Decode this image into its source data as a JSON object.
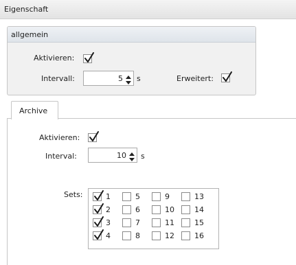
{
  "property_panel": {
    "title": "Eigenschaft"
  },
  "general_group": {
    "title": "allgemein",
    "activate_label": "Aktivieren:",
    "activate_checked": true,
    "interval_label": "Intervall:",
    "interval_value": "5",
    "interval_unit": "s",
    "extended_label": "Erweitert:",
    "extended_checked": true
  },
  "tabs": [
    {
      "label": "Archive",
      "active": true
    }
  ],
  "archive": {
    "activate_label": "Aktivieren:",
    "activate_checked": true,
    "interval_label": "Interval:",
    "interval_value": "10",
    "interval_unit": "s",
    "sets_label": "Sets:",
    "sets": [
      {
        "label": "1",
        "checked": true
      },
      {
        "label": "2",
        "checked": true
      },
      {
        "label": "3",
        "checked": true
      },
      {
        "label": "4",
        "checked": true
      },
      {
        "label": "5",
        "checked": false
      },
      {
        "label": "6",
        "checked": false
      },
      {
        "label": "7",
        "checked": false
      },
      {
        "label": "8",
        "checked": false
      },
      {
        "label": "9",
        "checked": false
      },
      {
        "label": "10",
        "checked": false
      },
      {
        "label": "11",
        "checked": false
      },
      {
        "label": "12",
        "checked": false
      },
      {
        "label": "13",
        "checked": false
      },
      {
        "label": "14",
        "checked": false
      },
      {
        "label": "15",
        "checked": false
      },
      {
        "label": "16",
        "checked": false
      }
    ]
  },
  "icons": {
    "check": "check-mark-icon",
    "spin_up": "spin-up-icon",
    "spin_down": "spin-down-icon"
  }
}
